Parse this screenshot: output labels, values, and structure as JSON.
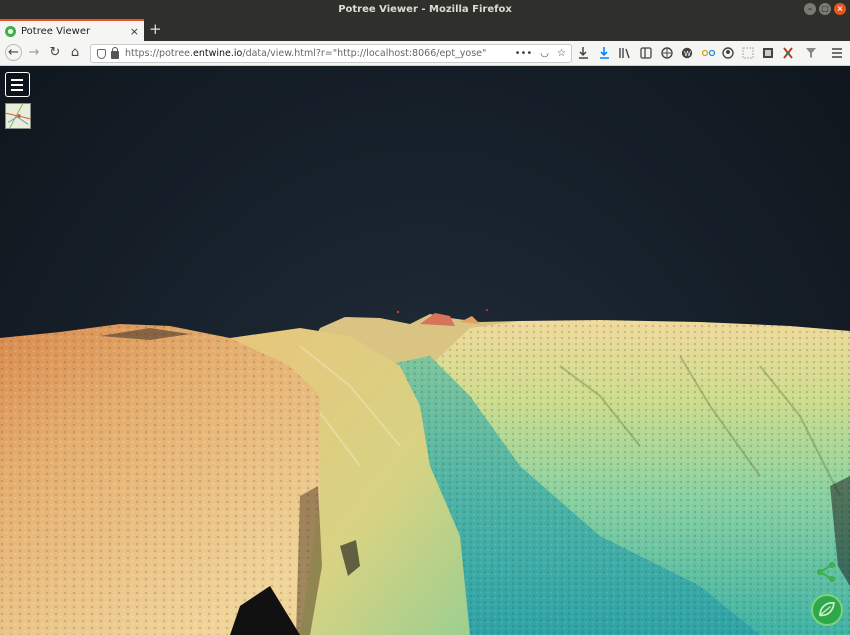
{
  "window": {
    "title": "Potree Viewer - Mozilla Firefox",
    "controls": {
      "minimize": "–",
      "maximize": "□",
      "close": "×"
    }
  },
  "tabs": [
    {
      "label": "Potree Viewer",
      "close": "×"
    }
  ],
  "new_tab": "+",
  "navbar": {
    "back": "←",
    "forward": "→",
    "reload": "↻",
    "home": "⌂",
    "url_prefix": "https://potree.",
    "url_domain": "entwine.io",
    "url_path": "/data/view.html?r=\"http://localhost:8066/ept_yose\"",
    "page_actions": "•••",
    "pocket": "◡",
    "bookmark": "☆"
  },
  "toolbar_icons": [
    "downloads-icon",
    "library-icon",
    "sidebar-icon",
    "extension-icon",
    "wordpress-icon",
    "glasses-icon",
    "account-icon",
    "container-icon",
    "screenshot-icon",
    "tools-icon",
    "filter-icon",
    "hamburger-menu-icon"
  ],
  "viewer": {
    "background_top": "#0f161d",
    "background_horizon": "#2b3b49",
    "terrain_colors": [
      "#d98a4e",
      "#e8c57b",
      "#c9d97f",
      "#79c9a0",
      "#3ab5a6"
    ]
  }
}
